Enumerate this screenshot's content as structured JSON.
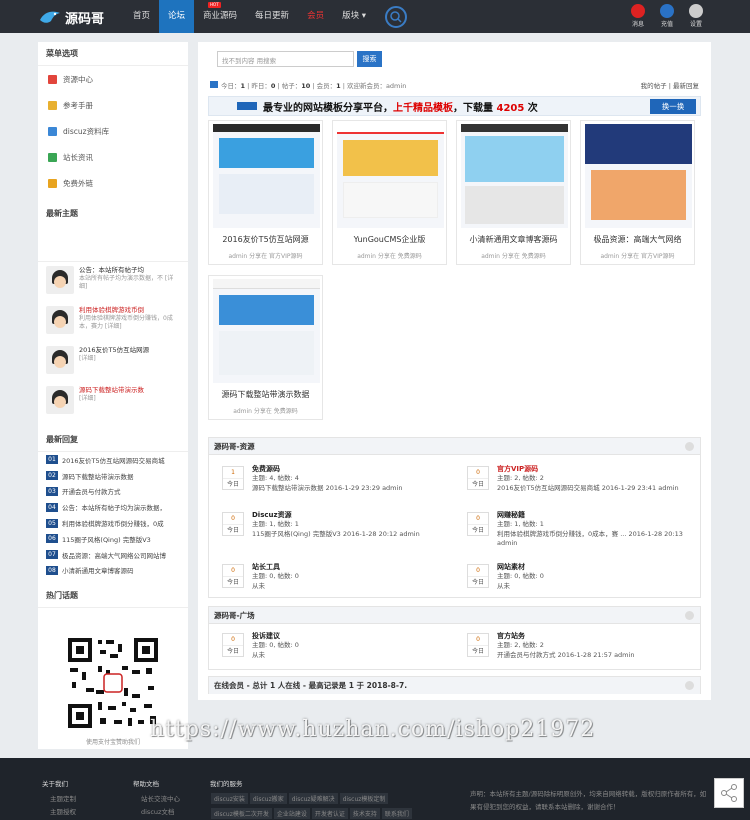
{
  "header": {
    "brand": "源码哥",
    "nav": [
      {
        "label": "首页",
        "active": false
      },
      {
        "label": "论坛",
        "active": true
      },
      {
        "label": "商业源码",
        "active": false,
        "badge": "HOT"
      },
      {
        "label": "每日更新",
        "active": false
      },
      {
        "label": "会员",
        "active": false,
        "highlight": true
      },
      {
        "label": "版块 ▾",
        "active": false
      }
    ],
    "user_links": [
      {
        "label": "消息",
        "color": "#d22"
      },
      {
        "label": "充值",
        "color": "#2a72c6"
      },
      {
        "label": "设置",
        "color": "#999"
      }
    ]
  },
  "sidebar": {
    "menu_title": "菜单选项",
    "menu": [
      {
        "label": "资源中心",
        "icon": "resource-icon",
        "color": "#e2453c"
      },
      {
        "label": "参考手册",
        "icon": "manual-icon",
        "color": "#e8b030"
      },
      {
        "label": "discuz资料库",
        "icon": "library-icon",
        "color": "#3b87d6"
      },
      {
        "label": "站长资讯",
        "icon": "news-icon",
        "color": "#3aa655"
      },
      {
        "label": "免费外链",
        "icon": "link-icon",
        "color": "#e8a420"
      }
    ],
    "new_topics_title": "最新主题",
    "topics": [
      {
        "title": "公告：本站所有帖子均",
        "desc": "本站所有帖子均为演示数据，不 [详细]",
        "red": false
      },
      {
        "title": "利用体验棋牌游戏币倒",
        "desc": "利用体验棋牌游戏币倒分赚钱，0成本，赛力 [详细]",
        "red": true
      },
      {
        "title": "2016友价T5仿互站网源",
        "desc": "[详细]",
        "red": false
      },
      {
        "title": "源码下载整站带演示数",
        "desc": "[详细]",
        "red": true
      }
    ],
    "replies_title": "最新回复",
    "replies": [
      {
        "num": "01",
        "text": "2016友价T5仿互站网源码交易商城"
      },
      {
        "num": "02",
        "text": "源码下载整站带演示数据"
      },
      {
        "num": "03",
        "text": "开通会员与付款方式"
      },
      {
        "num": "04",
        "text": "公告：本站所有帖子均为演示数据，"
      },
      {
        "num": "05",
        "text": "利用体验棋牌游戏币倒分赚钱，0成"
      },
      {
        "num": "06",
        "text": "115圈子风格(Qing) 完整版V3"
      },
      {
        "num": "07",
        "text": "极品资源：高端大气网络公司网站博"
      },
      {
        "num": "08",
        "text": "小清新通用文章博客源码"
      }
    ],
    "hot_title": "热门话题",
    "qr_caption": "使用支付宝赞助我们"
  },
  "main": {
    "search_placeholder": "找不到内容 用搜索",
    "search_button": "搜索",
    "stats": {
      "today_label": "今日：",
      "today": "1",
      "yesterday_label": "昨日：",
      "yesterday": "0",
      "posts_label": "帖子：",
      "posts": "10",
      "members_label": "会员：",
      "members": "1",
      "welcome": "欢迎新会员：admin"
    },
    "right_links": "我的帖子 | 最新回复",
    "banner": {
      "prefix": "最专业的网站模板分享平台，",
      "red": "上千精品模板",
      "mid": "，下载量 ",
      "count": "4205",
      "suffix": " 次",
      "button": "换一换"
    },
    "cards": [
      {
        "title": "2016友价T5仿互站网源",
        "meta": "admin 分享在 官方VIP源码"
      },
      {
        "title": "YunGouCMS企业版",
        "meta": "admin 分享在 免费源码"
      },
      {
        "title": "小清新通用文章博客源码",
        "meta": "admin 分享在 免费源码"
      },
      {
        "title": "极品资源：高端大气网络",
        "meta": "admin 分享在 官方VIP源码"
      },
      {
        "title": "源码下载整站带演示数据",
        "meta": "admin 分享在 免费源码"
      }
    ],
    "section1_title": "源码哥-资源",
    "section1_forums": [
      {
        "name": "免费源码",
        "today": "1",
        "day_label": "今日",
        "line1": "主题: 4, 帖数: 4",
        "line2": "源码下载整站带演示数据 2016-1-29 23:29 admin",
        "red": false
      },
      {
        "name": "官方VIP源码",
        "today": "0",
        "day_label": "今日",
        "line1": "主题: 2, 帖数: 2",
        "line2": "2016友价T5仿互站网源码交易商城 2016-1-29 23:41 admin",
        "red": true
      },
      {
        "name": "Discuz资源",
        "today": "0",
        "day_label": "今日",
        "line1": "主题: 1, 帖数: 1",
        "line2": "115圈子风格(Qing) 完整版V3 2016-1-28 20:12 admin",
        "red": false
      },
      {
        "name": "网赚秘籍",
        "today": "0",
        "day_label": "今日",
        "line1": "主题: 1, 帖数: 1",
        "line2": "利用体验棋牌游戏币倒分赚钱，0成本，赛 ... 2016-1-28 20:13 admin",
        "red": false
      },
      {
        "name": "站长工具",
        "today": "0",
        "day_label": "今日",
        "line1": "主题: 0, 帖数: 0",
        "line2": "从未",
        "red": false
      },
      {
        "name": "网站素材",
        "today": "0",
        "day_label": "今日",
        "line1": "主题: 0, 帖数: 0",
        "line2": "从未",
        "red": false
      }
    ],
    "section2_title": "源码哥-广场",
    "section2_forums": [
      {
        "name": "投诉建议",
        "today": "0",
        "day_label": "今日",
        "line1": "主题: 0, 帖数: 0",
        "line2": "从未",
        "red": false
      },
      {
        "name": "官方站务",
        "today": "0",
        "day_label": "今日",
        "line1": "主题: 2, 帖数: 2",
        "line2": "开通会员与付款方式 2016-1-28 21:57 admin",
        "red": false
      }
    ],
    "online": "在线会员 - 总计 1 人在线 - 最高记录是 1 于 2018-8-7."
  },
  "footer": {
    "col1_title": "关于我们",
    "col1_items": [
      "主题定制",
      "主题授权"
    ],
    "col2_title": "帮助文档",
    "col2_items": [
      "站长交流中心",
      "discuz文档"
    ],
    "col3_title": "我们的服务",
    "col3_tags": [
      "discuz安装",
      "discuz搬家",
      "discuz疑难解决",
      "discuz模板定制",
      "discuz模板二次开发",
      "企业站建设",
      "开发者认证",
      "技术支持",
      "联系我们"
    ],
    "declaration": "声明：本站所有主题/源码除标明原创外，均来自网络转载，版权归原作者所有，如果有侵犯到您的权益，请联系本站删除，谢谢合作！"
  },
  "watermark": "https://www.huzhan.com/ishop21972"
}
